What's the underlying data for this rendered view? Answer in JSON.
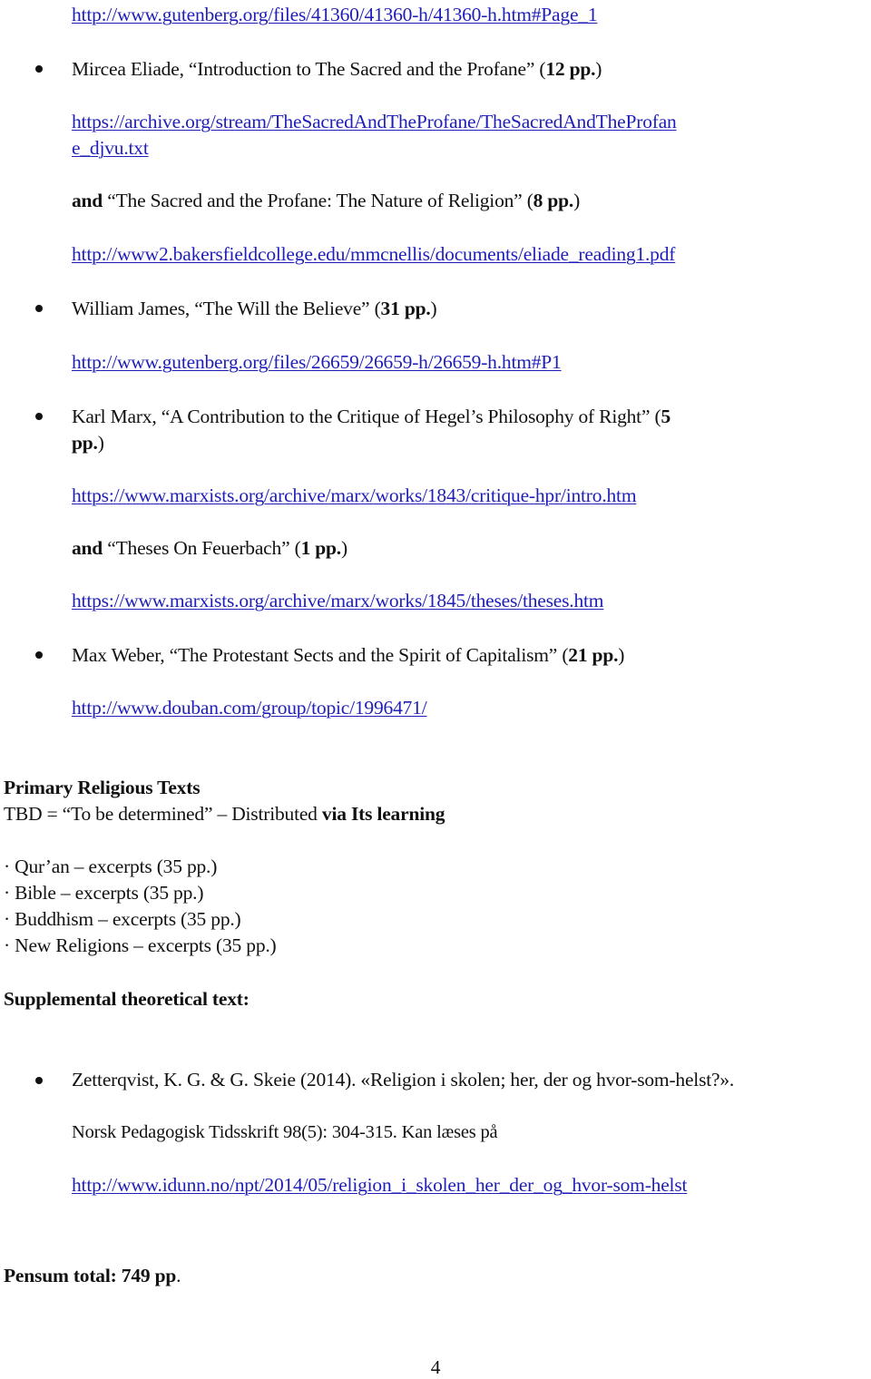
{
  "page": {
    "top_link": "http://www.gutenberg.org/files/41360/41360-h/41360-h.htm#Page_1",
    "readings": [
      {
        "author": "Mircea Eliade, ",
        "title": "“Introduction to The Sacred and the Profane”",
        "pages": "12 pp.",
        "link_line1": "https://archive.org/stream/TheSacredAndTheProfane/TheSacredAndTheProfan",
        "link_line2": "e_djvu.txt",
        "and_label": "and",
        "and_title": "“The Sacred and the Profane: The Nature of Religion”",
        "and_pages": "8 pp.",
        "and_link": "http://www2.bakersfieldcollege.edu/mmcnellis/documents/eliade_reading1.pdf"
      },
      {
        "author": "William James, ",
        "title": "“The Will the Believe”",
        "pages": "31 pp.",
        "link": "http://www.gutenberg.org/files/26659/26659-h/26659-h.htm#P1"
      },
      {
        "author": "Karl Marx, ",
        "title": "“A Contribution to the Critique of Hegel’s Philosophy of Right”",
        "pages_part1": "5",
        "pages_part2": "pp.",
        "link": "https://www.marxists.org/archive/marx/works/1843/critique-hpr/intro.htm",
        "and_label": "and",
        "and_title": "“Theses On Feuerbach”",
        "and_pages": "1 pp.",
        "and_link": "https://www.marxists.org/archive/marx/works/1845/theses/theses.htm"
      },
      {
        "author": "Max Weber, ",
        "title": "“The Protestant Sects and the Spirit of Capitalism”",
        "pages": "21 pp.",
        "link": "http://www.douban.com/group/topic/1996471/"
      }
    ],
    "primary": {
      "heading": "Primary Religious Texts",
      "tbd_text": "TBD = “To be determined” – Distributed ",
      "tbd_bold": "via Its learning",
      "items": [
        "· Qur’an – excerpts (35 pp.)",
        "· Bible – excerpts (35 pp.)",
        "· Buddhism – excerpts (35 pp.)",
        "· New Religions – excerpts (35 pp.)"
      ]
    },
    "supplemental": {
      "heading": "Supplemental theoretical text:",
      "citation_line1": "Zetterqvist, K. G. & G. Skeie (2014). «Religion i skolen; her, der og hvor-som-helst?».",
      "citation_line2": "Norsk Pedagogisk Tidsskrift 98(5): 304-315. Kan læses på",
      "link": "http://www.idunn.no/npt/2014/05/religion_i_skolen_her_der_og_hvor-som-helst"
    },
    "total_label": "Pensum total: 749 pp",
    "total_period": ".",
    "page_number": "4"
  }
}
